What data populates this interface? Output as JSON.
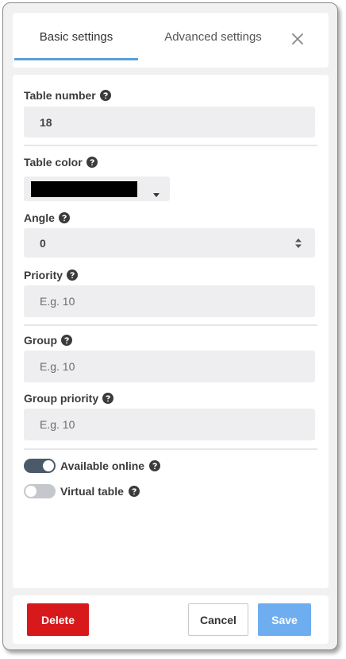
{
  "tabs": {
    "basic_label": "Basic settings",
    "advanced_label": "Advanced settings",
    "active": "basic"
  },
  "form": {
    "table_number": {
      "label": "Table number",
      "value": "18"
    },
    "table_color": {
      "label": "Table color",
      "value": "#000000"
    },
    "angle": {
      "label": "Angle",
      "value": "0"
    },
    "priority": {
      "label": "Priority",
      "placeholder": "E.g. 10"
    },
    "group": {
      "label": "Group",
      "placeholder": "E.g. 10"
    },
    "group_priority": {
      "label": "Group priority",
      "placeholder": "E.g. 10"
    }
  },
  "toggles": {
    "available_online": {
      "label": "Available online",
      "on": true
    },
    "virtual_table": {
      "label": "Virtual table",
      "on": false
    }
  },
  "footer": {
    "delete_label": "Delete",
    "cancel_label": "Cancel",
    "save_label": "Save"
  },
  "colors": {
    "accent": "#5a9fdb",
    "delete": "#d7191c",
    "save": "#6eaef0",
    "toggle_on": "#4a5a6a",
    "toggle_off": "#c4c8cc"
  },
  "icons": {
    "help": "question-circle-icon",
    "close": "close-icon",
    "caret": "caret-down-icon",
    "stepper": "sort-icon"
  }
}
